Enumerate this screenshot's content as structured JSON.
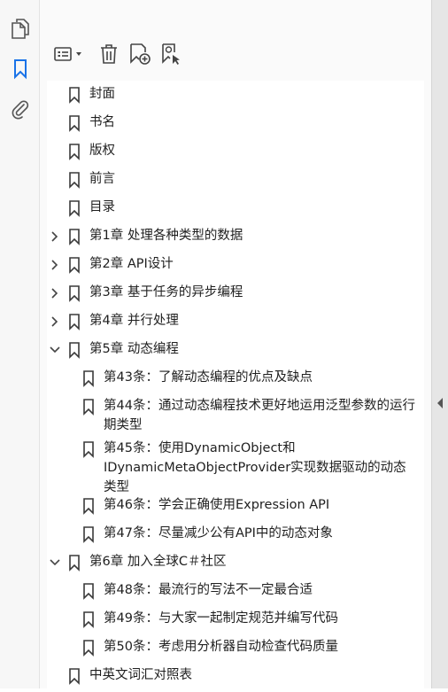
{
  "rail": {
    "items": [
      {
        "icon": "pages-icon"
      },
      {
        "icon": "bookmark-icon",
        "active": true
      },
      {
        "icon": "attachment-icon"
      }
    ]
  },
  "toolbar": {
    "options_icon": "list-options-icon",
    "delete_icon": "trash-icon",
    "new_bookmark_icon": "add-bookmark-icon",
    "find_bookmark_icon": "find-bookmark-icon"
  },
  "colors": {
    "accent": "#1a73e8",
    "icon": "#4a4a4a"
  },
  "bookmarks": [
    {
      "label": "封面",
      "level": 0,
      "expander": "none"
    },
    {
      "label": "书名",
      "level": 0,
      "expander": "none"
    },
    {
      "label": "版权",
      "level": 0,
      "expander": "none"
    },
    {
      "label": "前言",
      "level": 0,
      "expander": "none"
    },
    {
      "label": "目录",
      "level": 0,
      "expander": "none"
    },
    {
      "label": "第1章  处理各种类型的数据",
      "level": 0,
      "expander": "collapsed"
    },
    {
      "label": "第2章  API设计",
      "level": 0,
      "expander": "collapsed"
    },
    {
      "label": "第3章  基于任务的异步编程",
      "level": 0,
      "expander": "collapsed"
    },
    {
      "label": "第4章  并行处理",
      "level": 0,
      "expander": "collapsed"
    },
    {
      "label": "第5章  动态编程",
      "level": 0,
      "expander": "expanded"
    },
    {
      "label": "第43条：了解动态编程的优点及缺点",
      "level": 1,
      "expander": "none"
    },
    {
      "label": "第44条：通过动态编程技术更好地运用泛型参数的运行期类型",
      "level": 1,
      "expander": "none"
    },
    {
      "label": "第45条：使用DynamicObject和IDynamicMetaObjectProvider实现数据驱动的动态类型",
      "level": 1,
      "expander": "none"
    },
    {
      "label": "第46条：学会正确使用Expression API",
      "level": 1,
      "expander": "none"
    },
    {
      "label": "第47条：尽量减少公有API中的动态对象",
      "level": 1,
      "expander": "none"
    },
    {
      "label": "第6章  加入全球C＃社区",
      "level": 0,
      "expander": "expanded"
    },
    {
      "label": "第48条：最流行的写法不一定最合适",
      "level": 1,
      "expander": "none"
    },
    {
      "label": "第49条：与大家一起制定规范并编写代码",
      "level": 1,
      "expander": "none"
    },
    {
      "label": "第50条：考虑用分析器自动检查代码质量",
      "level": 1,
      "expander": "none"
    },
    {
      "label": "中英文词汇对照表",
      "level": 0,
      "expander": "none"
    }
  ]
}
